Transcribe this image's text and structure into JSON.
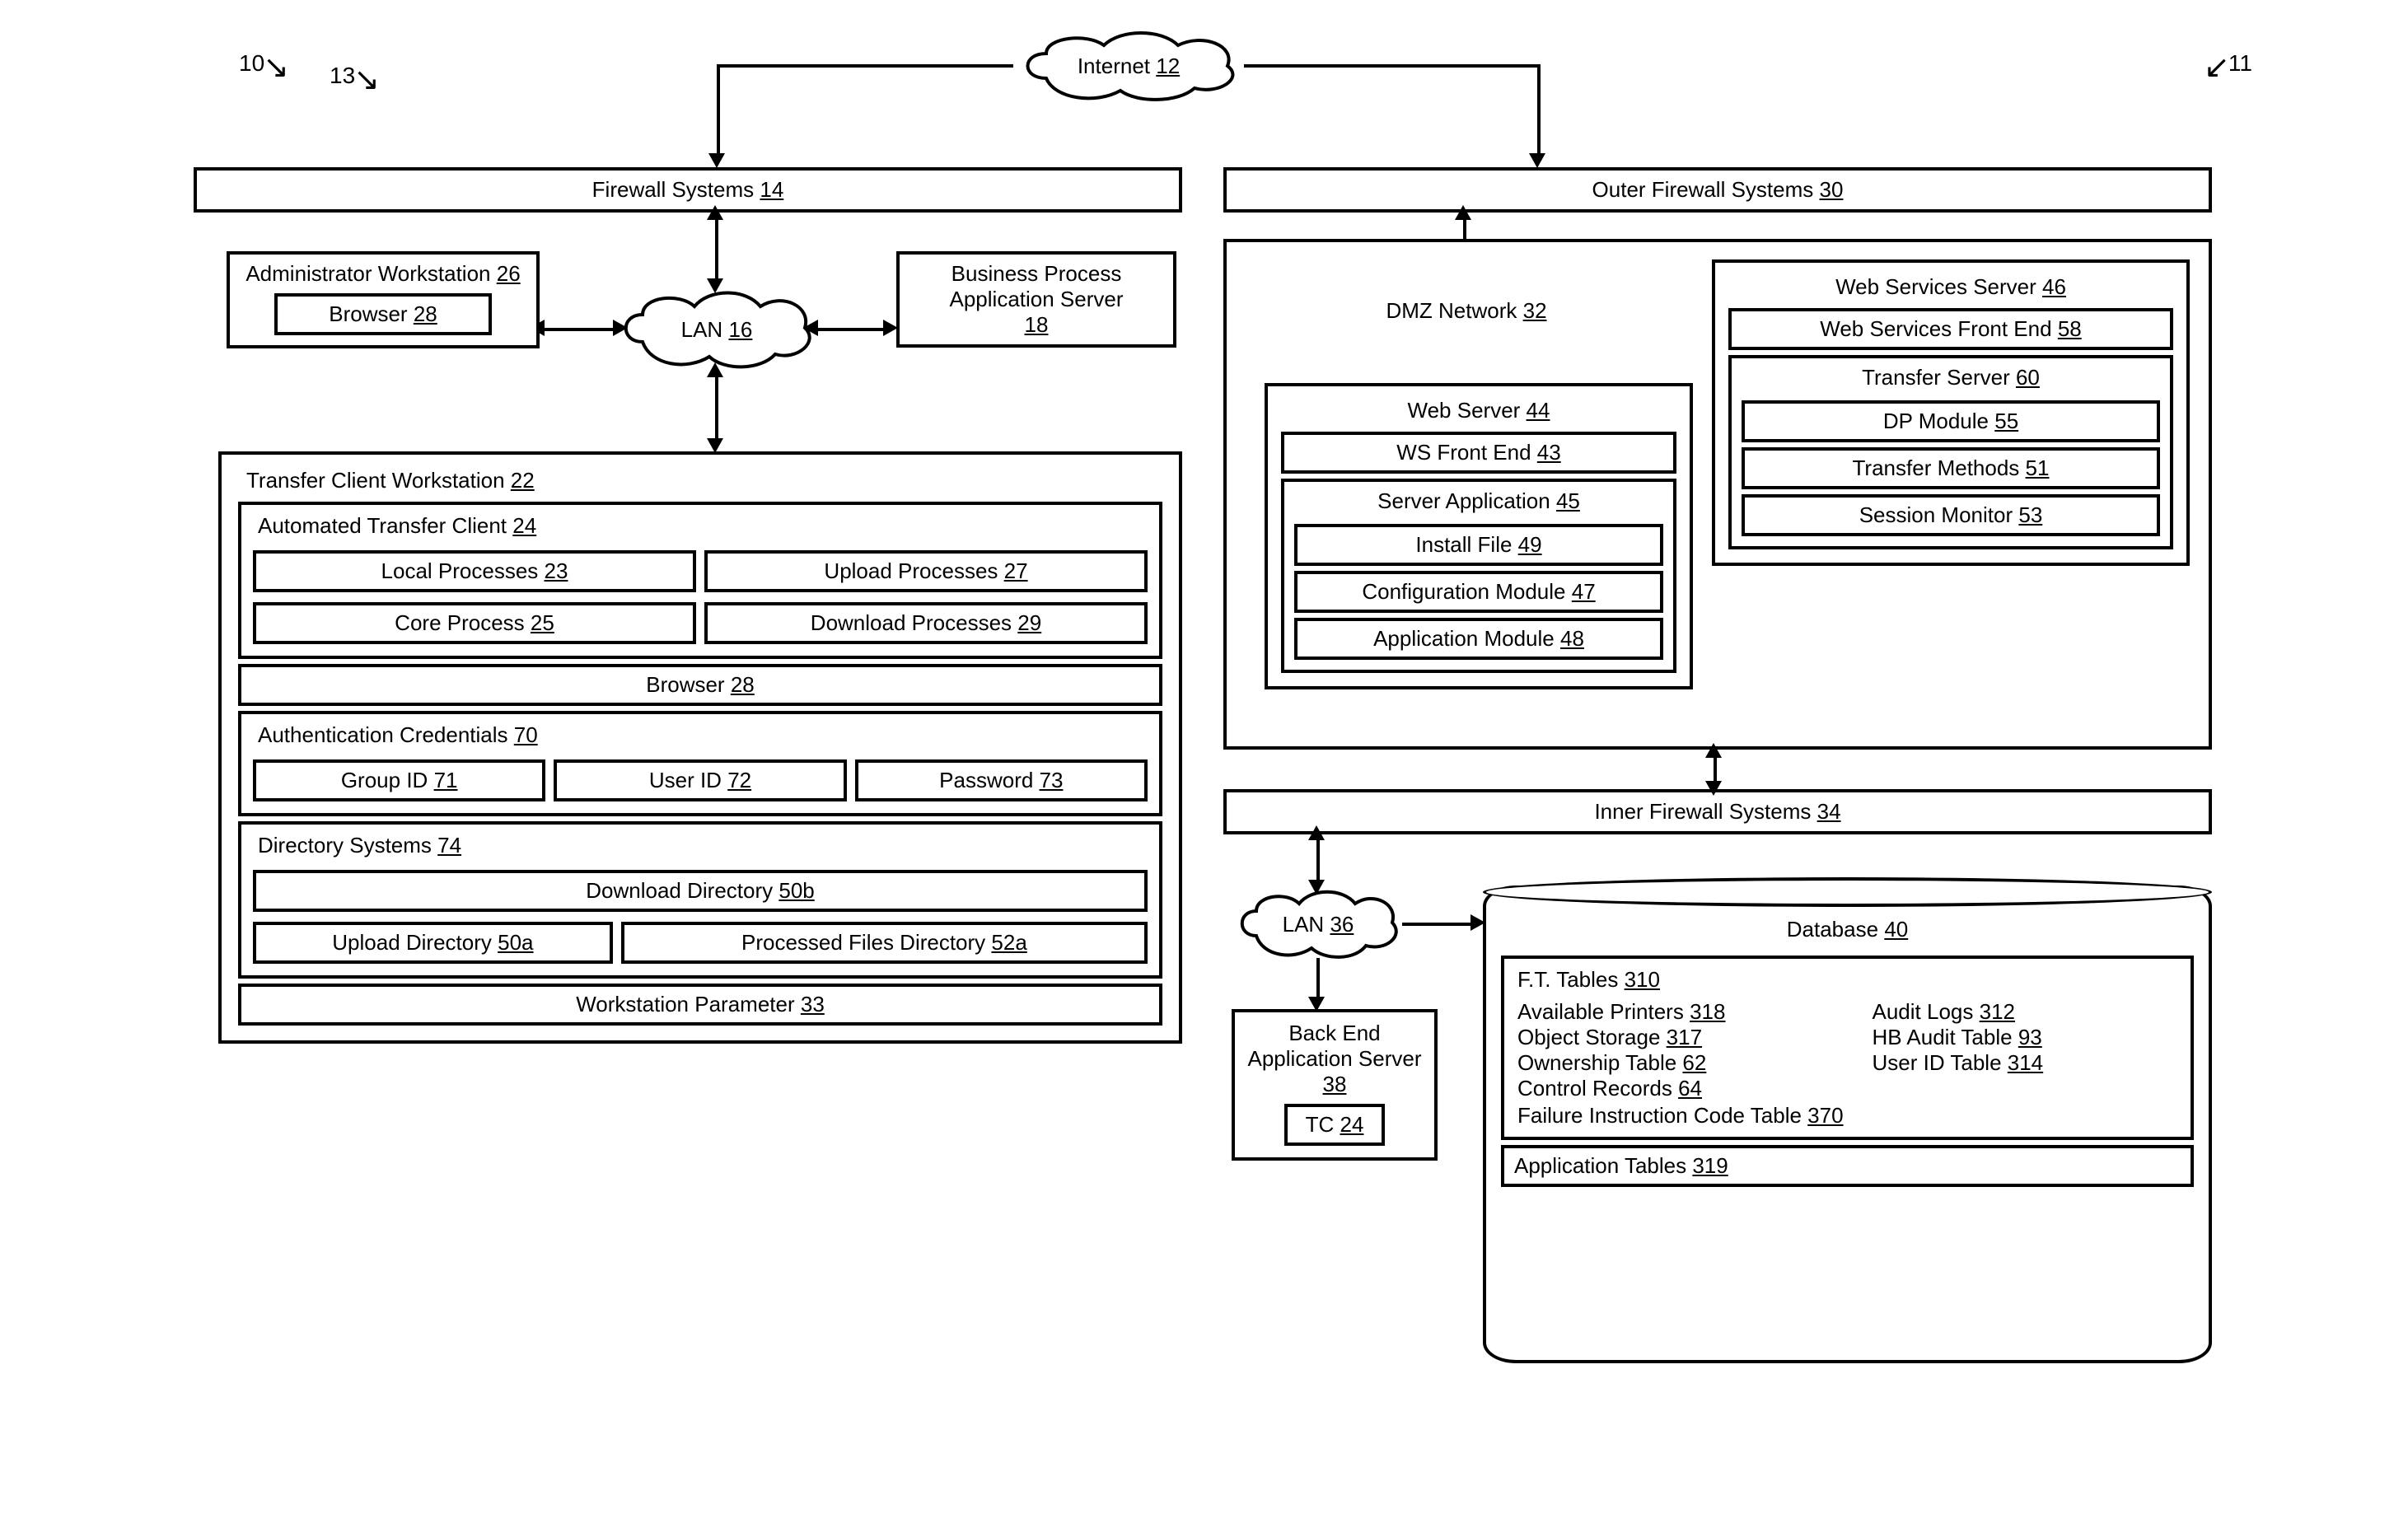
{
  "labels": {
    "n10": "10",
    "n13": "13",
    "n11": "11"
  },
  "internet": {
    "text": "Internet",
    "ref": "12"
  },
  "firewall14": {
    "text": "Firewall Systems",
    "ref": "14"
  },
  "outerFirewall30": {
    "text": "Outer Firewall Systems",
    "ref": "30"
  },
  "lan16": {
    "text": "LAN",
    "ref": "16"
  },
  "dmz32": {
    "text": "DMZ Network",
    "ref": "32"
  },
  "adminWorkstation": {
    "title": "Administrator Workstation",
    "ref": "26",
    "browser": "Browser",
    "browserRef": "28"
  },
  "bpServer": {
    "text": "Business Process Application Server",
    "ref": "18"
  },
  "tcw": {
    "title": "Transfer Client Workstation",
    "ref": "22",
    "atc": {
      "title": "Automated Transfer Client",
      "ref": "24",
      "lp": "Local Processes",
      "lpRef": "23",
      "up": "Upload Processes",
      "upRef": "27",
      "cp": "Core Process",
      "cpRef": "25",
      "dp": "Download Processes",
      "dpRef": "29"
    },
    "browser": "Browser",
    "browserRef": "28",
    "auth": {
      "title": "Authentication Credentials",
      "ref": "70",
      "gid": "Group ID",
      "gidRef": "71",
      "uid": "User ID",
      "uidRef": "72",
      "pwd": "Password",
      "pwdRef": "73"
    },
    "dir": {
      "title": "Directory Systems",
      "ref": "74",
      "dl": "Download Directory",
      "dlRef": "50b",
      "ul": "Upload Directory",
      "ulRef": "50a",
      "pf": "Processed Files Directory",
      "pfRef": "52a"
    },
    "wparam": "Workstation Parameter",
    "wparamRef": "33"
  },
  "webServer": {
    "title": "Web Server",
    "ref": "44",
    "wsfe": "WS Front End",
    "wsfeRef": "43",
    "sapp": {
      "title": "Server Application",
      "ref": "45",
      "install": "Install File",
      "installRef": "49",
      "config": "Configuration Module",
      "configRef": "47",
      "appmod": "Application Module",
      "appmodRef": "48"
    }
  },
  "wss": {
    "title": "Web Services Server",
    "ref": "46",
    "wsfe": "Web Services Front End",
    "wsfeRef": "58",
    "ts": {
      "title": "Transfer Server",
      "ref": "60",
      "dpmod": "DP Module",
      "dpmodRef": "55",
      "tm": "Transfer Methods",
      "tmRef": "51",
      "sm": "Session Monitor",
      "smRef": "53"
    }
  },
  "innerFirewall34": {
    "text": "Inner Firewall Systems",
    "ref": "34"
  },
  "lan36": {
    "text": "LAN",
    "ref": "36"
  },
  "beServer": {
    "title": "Back End Application Server",
    "ref": "38",
    "tc": "TC",
    "tcRef": "24"
  },
  "db": {
    "title": "Database",
    "ref": "40",
    "ft": {
      "title": "F.T. Tables",
      "ref": "310",
      "ap": "Available Printers",
      "apRef": "318",
      "os": "Object Storage",
      "osRef": "317",
      "ot": "Ownership Table",
      "otRef": "62",
      "cr": "Control Records",
      "crRef": "64",
      "fict": "Failure Instruction Code Table",
      "fictRef": "370",
      "al": "Audit Logs",
      "alRef": "312",
      "hb": "HB Audit Table",
      "hbRef": "93",
      "uid": "User ID Table",
      "uidRef": "314"
    },
    "app": "Application Tables",
    "appRef": "319"
  }
}
